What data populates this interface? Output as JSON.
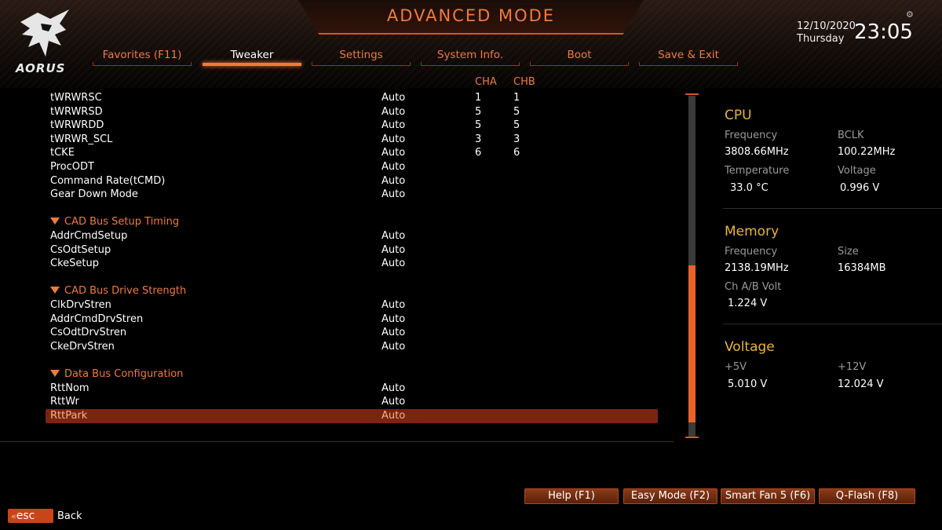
{
  "header": {
    "title": "ADVANCED MODE",
    "logo_text": "AORUS",
    "date": "12/10/2020",
    "day": "Thursday",
    "time": "23:05"
  },
  "tabs": [
    {
      "label": "Favorites (F11)"
    },
    {
      "label": "Tweaker"
    },
    {
      "label": "Settings"
    },
    {
      "label": "System Info."
    },
    {
      "label": "Boot"
    },
    {
      "label": "Save & Exit"
    }
  ],
  "columns": {
    "cha": "CHA",
    "chb": "CHB"
  },
  "rows": [
    {
      "name": "tWRWRSC",
      "value": "Auto",
      "cha": "1",
      "chb": "1"
    },
    {
      "name": "tWRWRSD",
      "value": "Auto",
      "cha": "5",
      "chb": "5"
    },
    {
      "name": "tWRWRDD",
      "value": "Auto",
      "cha": "5",
      "chb": "5"
    },
    {
      "name": "tWRWR_SCL",
      "value": "Auto",
      "cha": "3",
      "chb": "3"
    },
    {
      "name": "tCKE",
      "value": "Auto",
      "cha": "6",
      "chb": "6"
    },
    {
      "name": "ProcODT",
      "value": "Auto"
    },
    {
      "name": "Command Rate(tCMD)",
      "value": "Auto"
    },
    {
      "name": "Gear Down Mode",
      "value": "Auto"
    },
    {
      "section": "CAD Bus Setup Timing"
    },
    {
      "name": "AddrCmdSetup",
      "value": "Auto"
    },
    {
      "name": "CsOdtSetup",
      "value": "Auto"
    },
    {
      "name": "CkeSetup",
      "value": "Auto"
    },
    {
      "section": "CAD Bus Drive Strength"
    },
    {
      "name": "ClkDrvStren",
      "value": "Auto"
    },
    {
      "name": "AddrCmdDrvStren",
      "value": "Auto"
    },
    {
      "name": "CsOdtDrvStren",
      "value": "Auto"
    },
    {
      "name": "CkeDrvStren",
      "value": "Auto"
    },
    {
      "section": "Data Bus Configuration"
    },
    {
      "name": "RttNom",
      "value": "Auto"
    },
    {
      "name": "RttWr",
      "value": "Auto"
    },
    {
      "name": "RttPark",
      "value": "Auto",
      "selected": true
    }
  ],
  "sidebar": {
    "cpu": {
      "title": "CPU",
      "freq_label": "Frequency",
      "freq": "3808.66MHz",
      "bclk_label": "BCLK",
      "bclk": "100.22MHz",
      "temp_label": "Temperature",
      "temp": "33.0 °C",
      "volt_label": "Voltage",
      "volt": "0.996 V"
    },
    "memory": {
      "title": "Memory",
      "freq_label": "Frequency",
      "freq": "2138.19MHz",
      "size_label": "Size",
      "size": "16384MB",
      "volt_label": "Ch A/B Volt",
      "volt": "1.224 V"
    },
    "voltage": {
      "title": "Voltage",
      "v5_label": "+5V",
      "v5": "5.010 V",
      "v12_label": "+12V",
      "v12": "12.024 V"
    }
  },
  "footer": {
    "help": "Help (F1)",
    "easy": "Easy Mode (F2)",
    "fan": "Smart Fan 5 (F6)",
    "qflash": "Q-Flash (F8)",
    "esc": "esc",
    "back": "Back"
  },
  "colors": {
    "accent": "#f07a3c",
    "section": "#f07a3c",
    "sidebar_heading": "#e8b43a",
    "selected_row": "#7b2410"
  }
}
